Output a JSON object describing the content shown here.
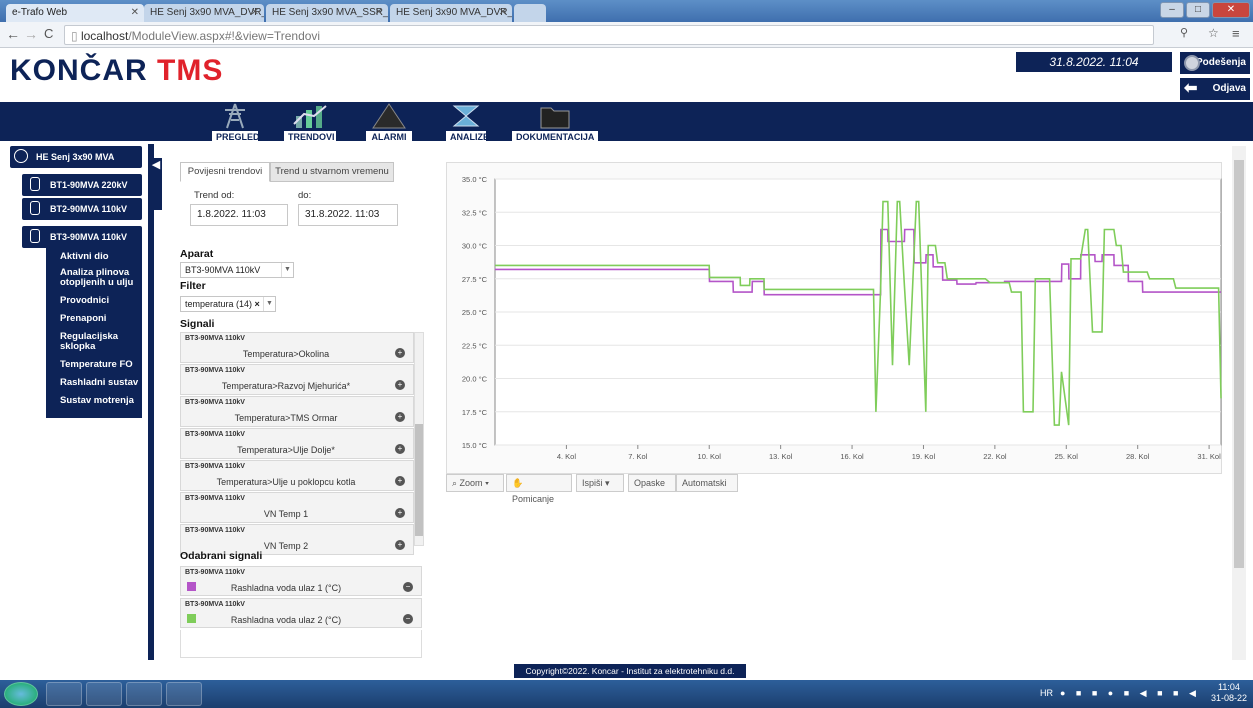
{
  "browser": {
    "tabs": [
      {
        "label": "e-Trafo Web"
      },
      {
        "label": "HE Senj 3x90 MVA_DVR_..."
      },
      {
        "label": "HE Senj 3x90 MVA_SSR_..."
      },
      {
        "label": "HE Senj 3x90 MVA_DVR_..."
      }
    ],
    "url_host": "localhost",
    "url_path": "/ModuleView.aspx#!&view=Trendovi"
  },
  "header": {
    "logo_main": "KONČAR",
    "logo_accent": "TMS",
    "datetime": "31.8.2022. 11:04",
    "settings_label": "Podešenja",
    "logout_label": "Odjava"
  },
  "nav": {
    "items": [
      {
        "label": "PREGLED",
        "icon": "tower-icon"
      },
      {
        "label": "TRENDOVI",
        "icon": "trend-icon"
      },
      {
        "label": "ALARMI",
        "icon": "alarm-icon"
      },
      {
        "label": "ANALIZE",
        "icon": "analysis-icon"
      },
      {
        "label": "DOKUMENTACIJA",
        "icon": "folder-icon"
      }
    ]
  },
  "tree": {
    "root": "HE Senj 3x90 MVA",
    "units": [
      "BT1-90MVA 220kV",
      "BT2-90MVA 110kV",
      "BT3-90MVA 110kV"
    ],
    "submenu": [
      "Aktivni dio",
      "Analiza plinova otopljenih u ulju",
      "Provodnici",
      "Prenaponi",
      "Regulacijska sklopka",
      "Temperature FO",
      "Rashladni sustav",
      "Sustav motrenja"
    ]
  },
  "panel": {
    "tab_history": "Povijesni trendovi",
    "tab_realtime": "Trend u stvarnom vremenu",
    "trend_from_label": "Trend od:",
    "trend_to_label": "do:",
    "trend_from": "1.8.2022. 11:03",
    "trend_to": "31.8.2022. 11:03",
    "device_label": "Aparat",
    "device_value": "BT3-90MVA 110kV",
    "filter_label": "Filter",
    "filter_value": "temperatura (14)",
    "signals_label": "Signali",
    "signals": [
      {
        "group": "BT3-90MVA 110kV",
        "name": "Temperatura>Okolina"
      },
      {
        "group": "BT3-90MVA 110kV",
        "name": "Temperatura>Razvoj Mjehurića*"
      },
      {
        "group": "BT3-90MVA 110kV",
        "name": "Temperatura>TMS Ormar"
      },
      {
        "group": "BT3-90MVA 110kV",
        "name": "Temperatura>Ulje Dolje*"
      },
      {
        "group": "BT3-90MVA 110kV",
        "name": "Temperatura>Ulje u poklopcu kotla"
      },
      {
        "group": "BT3-90MVA 110kV",
        "name": "VN Temp 1"
      },
      {
        "group": "BT3-90MVA 110kV",
        "name": "VN Temp 2"
      }
    ],
    "selected_label": "Odabrani signali",
    "selected": [
      {
        "group": "BT3-90MVA 110kV",
        "name": "Rashladna voda ulaz 1 (°C)",
        "color": "#b455c8"
      },
      {
        "group": "BT3-90MVA 110kV",
        "name": "Rashladna voda ulaz 2 (°C)",
        "color": "#7fcd5a"
      }
    ]
  },
  "toolbar": {
    "zoom": "Zoom",
    "pan": "Pomicanje",
    "print": "Ispiši",
    "notes": "Opaske",
    "auto": "Automatski"
  },
  "chart_data": {
    "type": "line",
    "ylim": [
      15,
      35
    ],
    "xlim": [
      1,
      31.5
    ],
    "y_ticks": [
      "15.0 °C",
      "17.5 °C",
      "20.0 °C",
      "22.5 °C",
      "25.0 °C",
      "27.5 °C",
      "30.0 °C",
      "32.5 °C",
      "35.0 °C"
    ],
    "x_ticks": [
      "4. Kol",
      "7. Kol",
      "10. Kol",
      "13. Kol",
      "16. Kol",
      "19. Kol",
      "22. Kol",
      "25. Kol",
      "28. Kol",
      "31. Kol"
    ],
    "x_tick_values": [
      4,
      7,
      10,
      13,
      16,
      19,
      22,
      25,
      28,
      31
    ],
    "series": [
      {
        "name": "Rashladna voda ulaz 1 (°C)",
        "color": "#b455c8",
        "x": [
          1,
          10,
          10.01,
          11,
          11.01,
          11.8,
          11.81,
          12.3,
          12.31,
          12.6,
          12.61,
          17.2,
          17.21,
          17.5,
          17.51,
          18.2,
          18.21,
          18.6,
          18.61,
          19.1,
          19.11,
          19.4,
          19.41,
          19.8,
          19.81,
          20.4,
          20.41,
          21.2,
          21.21,
          22.4,
          22.41,
          24.8,
          24.81,
          25.1,
          25.11,
          25.6,
          25.61,
          26.2,
          26.21,
          26.5,
          26.51,
          27,
          27.01,
          27.6,
          27.61,
          28.2,
          28.21,
          31.5
        ],
        "y": [
          28.2,
          28.2,
          27.3,
          27.3,
          26.5,
          26.5,
          27.3,
          27.3,
          26.3,
          26.3,
          26.3,
          26.3,
          31.2,
          31.2,
          30.3,
          30.3,
          31.2,
          31.2,
          28.7,
          28.7,
          29.3,
          29.3,
          28.4,
          28.4,
          27.4,
          27.4,
          27.1,
          27.1,
          27.2,
          27.2,
          27.3,
          27.3,
          28.6,
          28.6,
          27.5,
          27.5,
          29.3,
          29.3,
          28.8,
          28.8,
          29.3,
          29.3,
          28.5,
          28.5,
          27.3,
          27.3,
          26.5,
          26.5
        ]
      },
      {
        "name": "Rashladna voda ulaz 2 (°C)",
        "color": "#7fcd5a",
        "x": [
          1,
          10,
          10.01,
          11.3,
          11.31,
          11.7,
          11.71,
          12.3,
          12.31,
          16.9,
          17,
          17.2,
          17.3,
          17.5,
          17.7,
          17.9,
          18,
          18.2,
          18.4,
          18.7,
          18.8,
          19.1,
          19.2,
          19.5,
          19.6,
          19.9,
          20,
          21.6,
          21.8,
          22.6,
          22.7,
          23.1,
          23.2,
          23.6,
          23.7,
          24.3,
          24.5,
          24.7,
          24.8,
          25.1,
          25.2,
          25.6,
          25.8,
          25.9,
          26.1,
          26.5,
          26.6,
          27,
          27.1,
          27.3,
          27.4,
          28.4,
          28.5,
          29.5,
          29.6,
          31.4,
          31.5
        ],
        "y": [
          28.5,
          28.5,
          27.6,
          27.6,
          27,
          27,
          27.5,
          27.5,
          26.7,
          26.7,
          17.5,
          26.7,
          33.3,
          33.3,
          21,
          33.3,
          33.3,
          27,
          21,
          33.3,
          33.3,
          17.5,
          30,
          30,
          28.7,
          28.7,
          27.5,
          27.5,
          27.2,
          27.2,
          26.5,
          26.5,
          17.5,
          17.5,
          27.5,
          27.5,
          16.5,
          16.5,
          20.5,
          16.5,
          29,
          29,
          31.2,
          31.2,
          23.5,
          23.5,
          31.2,
          31.2,
          30,
          30,
          28,
          28,
          27.5,
          27.5,
          26.8,
          26.8,
          18.5
        ]
      }
    ]
  },
  "footer": {
    "copyright": "Copyright©2022. Koncar - Institut za elektrotehniku d.d."
  },
  "taskbar": {
    "lang": "HR",
    "time": "11:04",
    "date": "31-08-22"
  }
}
